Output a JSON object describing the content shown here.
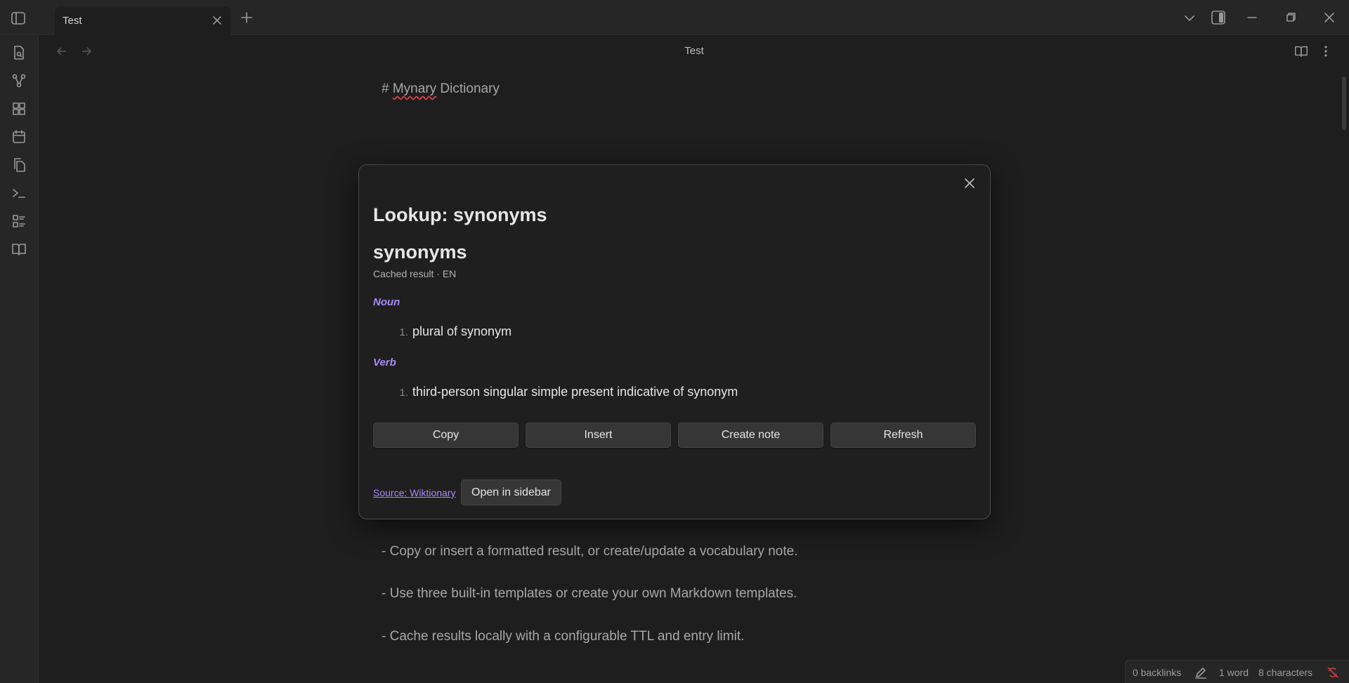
{
  "app": {
    "tab_title": "Test",
    "view_title": "Test"
  },
  "icons": {
    "ribbon": [
      "file-search-icon",
      "graph-icon",
      "dashboard-icon",
      "calendar-icon",
      "copy-pages-icon",
      "terminal-icon",
      "checklist-icon",
      "book-open-icon"
    ],
    "titlebar": [
      "sidebar-toggle-icon",
      "close-icon",
      "plus-icon",
      "chevron-down-icon",
      "right-sidebar-icon",
      "minimize-icon",
      "restore-icon",
      "close-window-icon"
    ]
  },
  "editor": {
    "heading_hash": "# ",
    "heading_word_1": "Mynary",
    "heading_rest": " Dictionary",
    "lines": [
      "- Copy or insert a formatted result, or create/update a vocabulary note.",
      "- Use three built-in templates or create your own Markdown templates.",
      "- Cache results locally with a configurable TTL and entry limit."
    ]
  },
  "modal": {
    "title": "Lookup: synonyms",
    "word": "synonyms",
    "meta": "Cached result · EN",
    "noun_label": "Noun",
    "noun_def_num": "1.",
    "noun_def": "plural of synonym",
    "verb_label": "Verb",
    "verb_def_num": "1.",
    "verb_def": "third-person singular simple present indicative of synonym",
    "buttons": {
      "copy": "Copy",
      "insert": "Insert",
      "create_note": "Create note",
      "refresh": "Refresh"
    },
    "source": "Source: Wiktionary",
    "open_sidebar": "Open in sidebar"
  },
  "status": {
    "backlinks": "0 backlinks",
    "words": "1 word",
    "characters": "8 characters"
  },
  "colors": {
    "accent": "#a88bfa",
    "background": "#1e1e1e",
    "chrome": "#262626"
  }
}
